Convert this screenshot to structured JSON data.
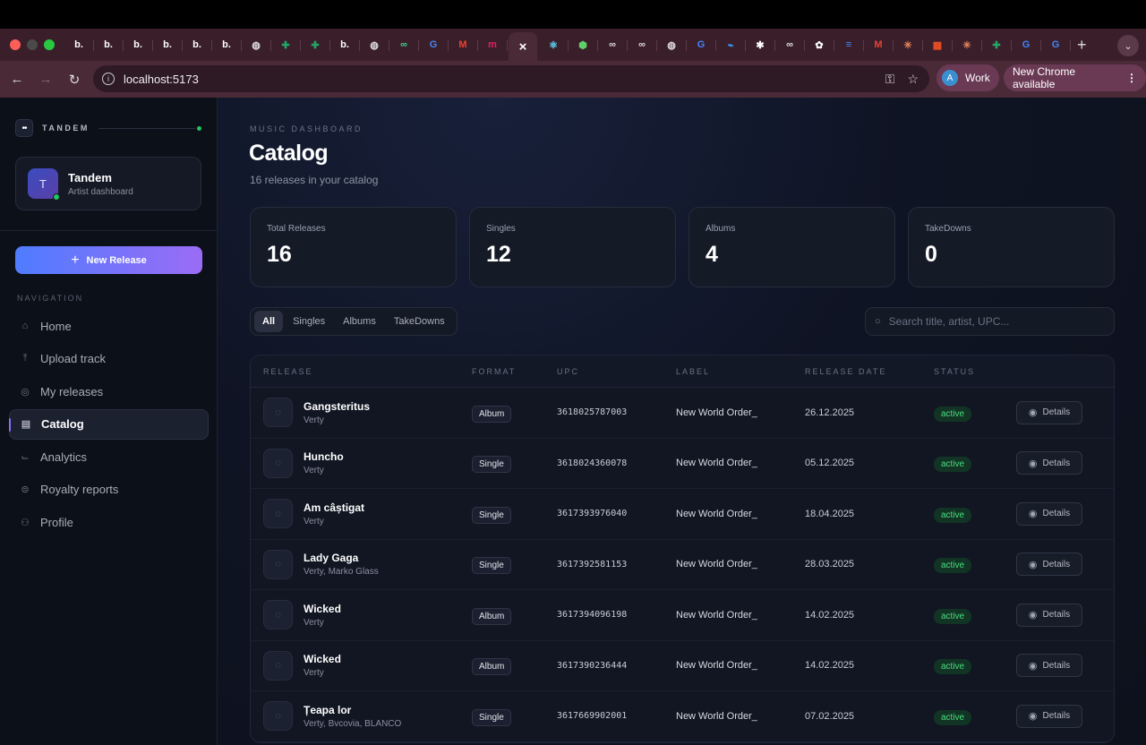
{
  "browser": {
    "tabs": [
      {
        "icon": "b-logo-icon",
        "glyph": "b.",
        "color": "#ffffff"
      },
      {
        "icon": "b-logo-icon",
        "glyph": "b.",
        "color": "#ffffff"
      },
      {
        "icon": "b-logo-icon",
        "glyph": "b.",
        "color": "#ffffff"
      },
      {
        "icon": "b-logo-icon",
        "glyph": "b.",
        "color": "#ffffff"
      },
      {
        "icon": "b-logo-icon",
        "glyph": "b.",
        "color": "#ffffff"
      },
      {
        "icon": "b-logo-icon",
        "glyph": "b.",
        "color": "#ffffff"
      },
      {
        "icon": "globe-icon",
        "glyph": "◍",
        "color": "#dddddd"
      },
      {
        "icon": "sheets-icon",
        "glyph": "✚",
        "color": "#23a566"
      },
      {
        "icon": "sheets-icon",
        "glyph": "✚",
        "color": "#23a566"
      },
      {
        "icon": "b-logo-icon",
        "glyph": "b.",
        "color": "#ffffff"
      },
      {
        "icon": "globe-icon",
        "glyph": "◍",
        "color": "#dddddd"
      },
      {
        "icon": "chain-icon",
        "glyph": "∞",
        "color": "#3ecf8e"
      },
      {
        "icon": "google-icon",
        "glyph": "G",
        "color": "#4285f4"
      },
      {
        "icon": "gmail-icon",
        "glyph": "M",
        "color": "#ea4335"
      },
      {
        "icon": "miro-icon",
        "glyph": "m",
        "color": "#e91e63"
      },
      {
        "icon": "close-icon",
        "glyph": "×",
        "color": "#ffffff",
        "active": true
      },
      {
        "icon": "react-icon",
        "glyph": "⚛",
        "color": "#61dafb"
      },
      {
        "icon": "hexagon-icon",
        "glyph": "⬢",
        "color": "#5fd068"
      },
      {
        "icon": "infinity-icon",
        "glyph": "∞",
        "color": "#dddddd"
      },
      {
        "icon": "infinity-icon",
        "glyph": "∞",
        "color": "#dddddd"
      },
      {
        "icon": "globe-icon",
        "glyph": "◍",
        "color": "#dddddd"
      },
      {
        "icon": "google-icon",
        "glyph": "G",
        "color": "#4285f4"
      },
      {
        "icon": "vscode-icon",
        "glyph": "⌁",
        "color": "#3aa0ff"
      },
      {
        "icon": "sparkle-icon",
        "glyph": "✱",
        "color": "#ffffff"
      },
      {
        "icon": "infinity-icon",
        "glyph": "∞",
        "color": "#dddddd"
      },
      {
        "icon": "openai-icon",
        "glyph": "✿",
        "color": "#ffffff"
      },
      {
        "icon": "docs-icon",
        "glyph": "≡",
        "color": "#4a8af4"
      },
      {
        "icon": "gmail-icon",
        "glyph": "M",
        "color": "#ea4335"
      },
      {
        "icon": "claude-icon",
        "glyph": "✳",
        "color": "#e8865a"
      },
      {
        "icon": "microsoft-icon",
        "glyph": "▦",
        "color": "#f25022"
      },
      {
        "icon": "claude-icon",
        "glyph": "✳",
        "color": "#e8865a"
      },
      {
        "icon": "sheets-icon",
        "glyph": "✚",
        "color": "#23a566"
      },
      {
        "icon": "google-icon",
        "glyph": "G",
        "color": "#4285f4"
      },
      {
        "icon": "google-icon",
        "glyph": "G",
        "color": "#4285f4"
      }
    ],
    "url": "localhost:5173",
    "profile_initial": "A",
    "profile_name": "Work",
    "update_label": "New Chrome available"
  },
  "sidebar": {
    "brand": "TANDEM",
    "artist": {
      "initial": "T",
      "name": "Tandem",
      "role": "Artist dashboard"
    },
    "new_release_label": "New Release",
    "nav_label": "NAVIGATION",
    "items": [
      {
        "label": "Home",
        "icon": "home-icon",
        "glyph": "⌂"
      },
      {
        "label": "Upload track",
        "icon": "upload-icon",
        "glyph": "⤒"
      },
      {
        "label": "My releases",
        "icon": "disc-icon",
        "glyph": "◎"
      },
      {
        "label": "Catalog",
        "icon": "catalog-icon",
        "glyph": "▤",
        "active": true
      },
      {
        "label": "Analytics",
        "icon": "chart-icon",
        "glyph": "⌙"
      },
      {
        "label": "Royalty reports",
        "icon": "dollar-icon",
        "glyph": "⊜"
      },
      {
        "label": "Profile",
        "icon": "user-icon",
        "glyph": "⚇"
      }
    ]
  },
  "main": {
    "eyebrow": "MUSIC DASHBOARD",
    "title": "Catalog",
    "subtitle": "16 releases in your catalog",
    "stats": [
      {
        "label": "Total Releases",
        "value": "16"
      },
      {
        "label": "Singles",
        "value": "12"
      },
      {
        "label": "Albums",
        "value": "4"
      },
      {
        "label": "TakeDowns",
        "value": "0"
      }
    ],
    "filters": [
      {
        "label": "All",
        "active": true
      },
      {
        "label": "Singles"
      },
      {
        "label": "Albums"
      },
      {
        "label": "TakeDowns"
      }
    ],
    "search_placeholder": "Search title, artist, UPC...",
    "table": {
      "headers": [
        "RELEASE",
        "FORMAT",
        "UPC",
        "LABEL",
        "RELEASE DATE",
        "STATUS"
      ],
      "details_label": "Details",
      "rows": [
        {
          "title": "Gangsteritus",
          "artist": "Verty",
          "format": "Album",
          "upc": "3618025787003",
          "label": "New World Order_",
          "date": "26.12.2025",
          "status": "active"
        },
        {
          "title": "Huncho",
          "artist": "Verty",
          "format": "Single",
          "upc": "3618024360078",
          "label": "New World Order_",
          "date": "05.12.2025",
          "status": "active"
        },
        {
          "title": "Am câștigat",
          "artist": "Verty",
          "format": "Single",
          "upc": "3617393976040",
          "label": "New World Order_",
          "date": "18.04.2025",
          "status": "active"
        },
        {
          "title": "Lady Gaga",
          "artist": "Verty, Marko Glass",
          "format": "Single",
          "upc": "3617392581153",
          "label": "New World Order_",
          "date": "28.03.2025",
          "status": "active"
        },
        {
          "title": "Wicked",
          "artist": "Verty",
          "format": "Album",
          "upc": "3617394096198",
          "label": "New World Order_",
          "date": "14.02.2025",
          "status": "active"
        },
        {
          "title": "Wicked",
          "artist": "Verty",
          "format": "Album",
          "upc": "3617390236444",
          "label": "New World Order_",
          "date": "14.02.2025",
          "status": "active"
        },
        {
          "title": "Țeapa lor",
          "artist": "Verty, Bvcovia, BLANCO",
          "format": "Single",
          "upc": "3617669902001",
          "label": "New World Order_",
          "date": "07.02.2025",
          "status": "active"
        }
      ]
    }
  }
}
